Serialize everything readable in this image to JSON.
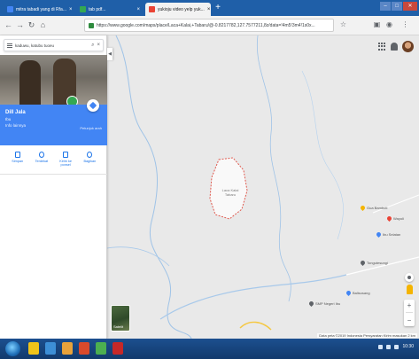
{
  "browser": {
    "tabs": [
      {
        "label": "mitra tabadi yang di Rfa...",
        "favicon_color": "#4285f4",
        "active": false
      },
      {
        "label": "tab pdf...",
        "favicon_color": "#34a853",
        "active": false
      },
      {
        "label": "yukioju video yelp yuk...",
        "favicon_color": "#ea4335",
        "active": false
      }
    ],
    "new_tab": "+",
    "window_controls": {
      "minimize": "–",
      "maximize": "□",
      "close": "✕"
    },
    "back": "←",
    "forward": "→",
    "reload": "↻",
    "home": "⌂",
    "url": "https://www.google.com/maps/place/Laca+Kalai,+Tabaru/@-0.8217782,127.7577211,8z/data=!4m5!3m4!1s0x..."
  },
  "panel": {
    "search_query": "kaduwu, katubu tuoeu",
    "place_name": "Dill Jala",
    "place_type": "Ibu",
    "place_sub": "Info lainnya",
    "directions_label": "Petunjuk arah",
    "actions": [
      {
        "label": "Simpan"
      },
      {
        "label": "Terdekat"
      },
      {
        "label": "Kirim ke ponsel"
      },
      {
        "label": "Bagikan"
      }
    ],
    "collapse": "◀"
  },
  "map": {
    "area_label": "Laca Kalai\nTabaru",
    "pois": [
      {
        "label": "Gua Bambuti",
        "color": "#f4b400"
      },
      {
        "label": "Wayoli",
        "color": "#ea4335"
      },
      {
        "label": "Ibu Selatan",
        "color": "#4285f4"
      },
      {
        "label": "Tongutesungi",
        "color": "#5f6368"
      },
      {
        "label": "Balisosang",
        "color": "#4285f4"
      },
      {
        "label": "SMP Negeri Ibu",
        "color": "#5f6368"
      }
    ],
    "layers_label": "Satelit",
    "zoom_in": "+",
    "zoom_out": "−",
    "footer": "Data peta ©2019  Indonesia  Persyaratan  Kirim masukan  2 km"
  },
  "taskbar": {
    "apps": [
      {
        "color": "#f0c419"
      },
      {
        "color": "#3d8fd6"
      },
      {
        "color": "#e8a23a"
      },
      {
        "color": "#d94a2b"
      },
      {
        "color": "#4caf50"
      },
      {
        "color": "#c62828"
      }
    ],
    "clock": "10:30"
  }
}
